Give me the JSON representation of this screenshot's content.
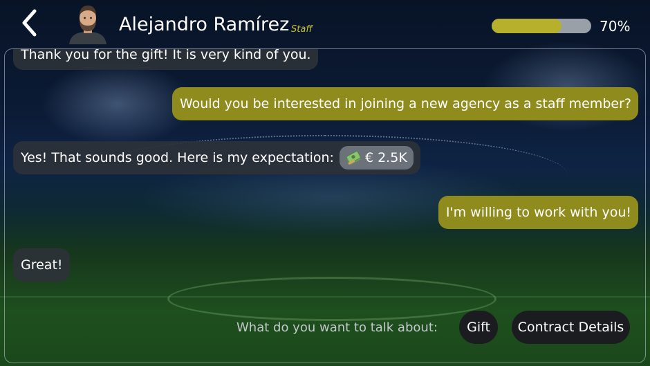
{
  "header": {
    "back_icon": "chevron-left-icon",
    "avatar_icon": "person-avatar-icon",
    "name": "Alejandro Ramírez",
    "role": "Staff",
    "progress": {
      "value_percent": 70,
      "fill_fraction": 0.7,
      "label": "70%",
      "fill_color": "#b6b02c",
      "track_color": "#9aa0a8"
    }
  },
  "chat": {
    "messages": [
      {
        "sender": "npc",
        "text": "Thank you for the gift! It is very kind of you."
      },
      {
        "sender": "player",
        "text": "Would you be interested in joining a new agency as a staff member?"
      },
      {
        "sender": "npc",
        "text": "Yes! That sounds good. Here is my expectation:",
        "chip": {
          "icon": "money-icon",
          "text": "€ 2.5K"
        }
      },
      {
        "sender": "player",
        "text": "I'm willing to work with you!"
      },
      {
        "sender": "npc",
        "text": "Great!"
      }
    ],
    "colors": {
      "npc_bubble": "#2d3238",
      "player_bubble": "#8f8c1d"
    }
  },
  "options": {
    "prompt": "What do you want to talk about:",
    "buttons": [
      {
        "label": "Gift"
      },
      {
        "label": "Contract Details"
      }
    ]
  }
}
